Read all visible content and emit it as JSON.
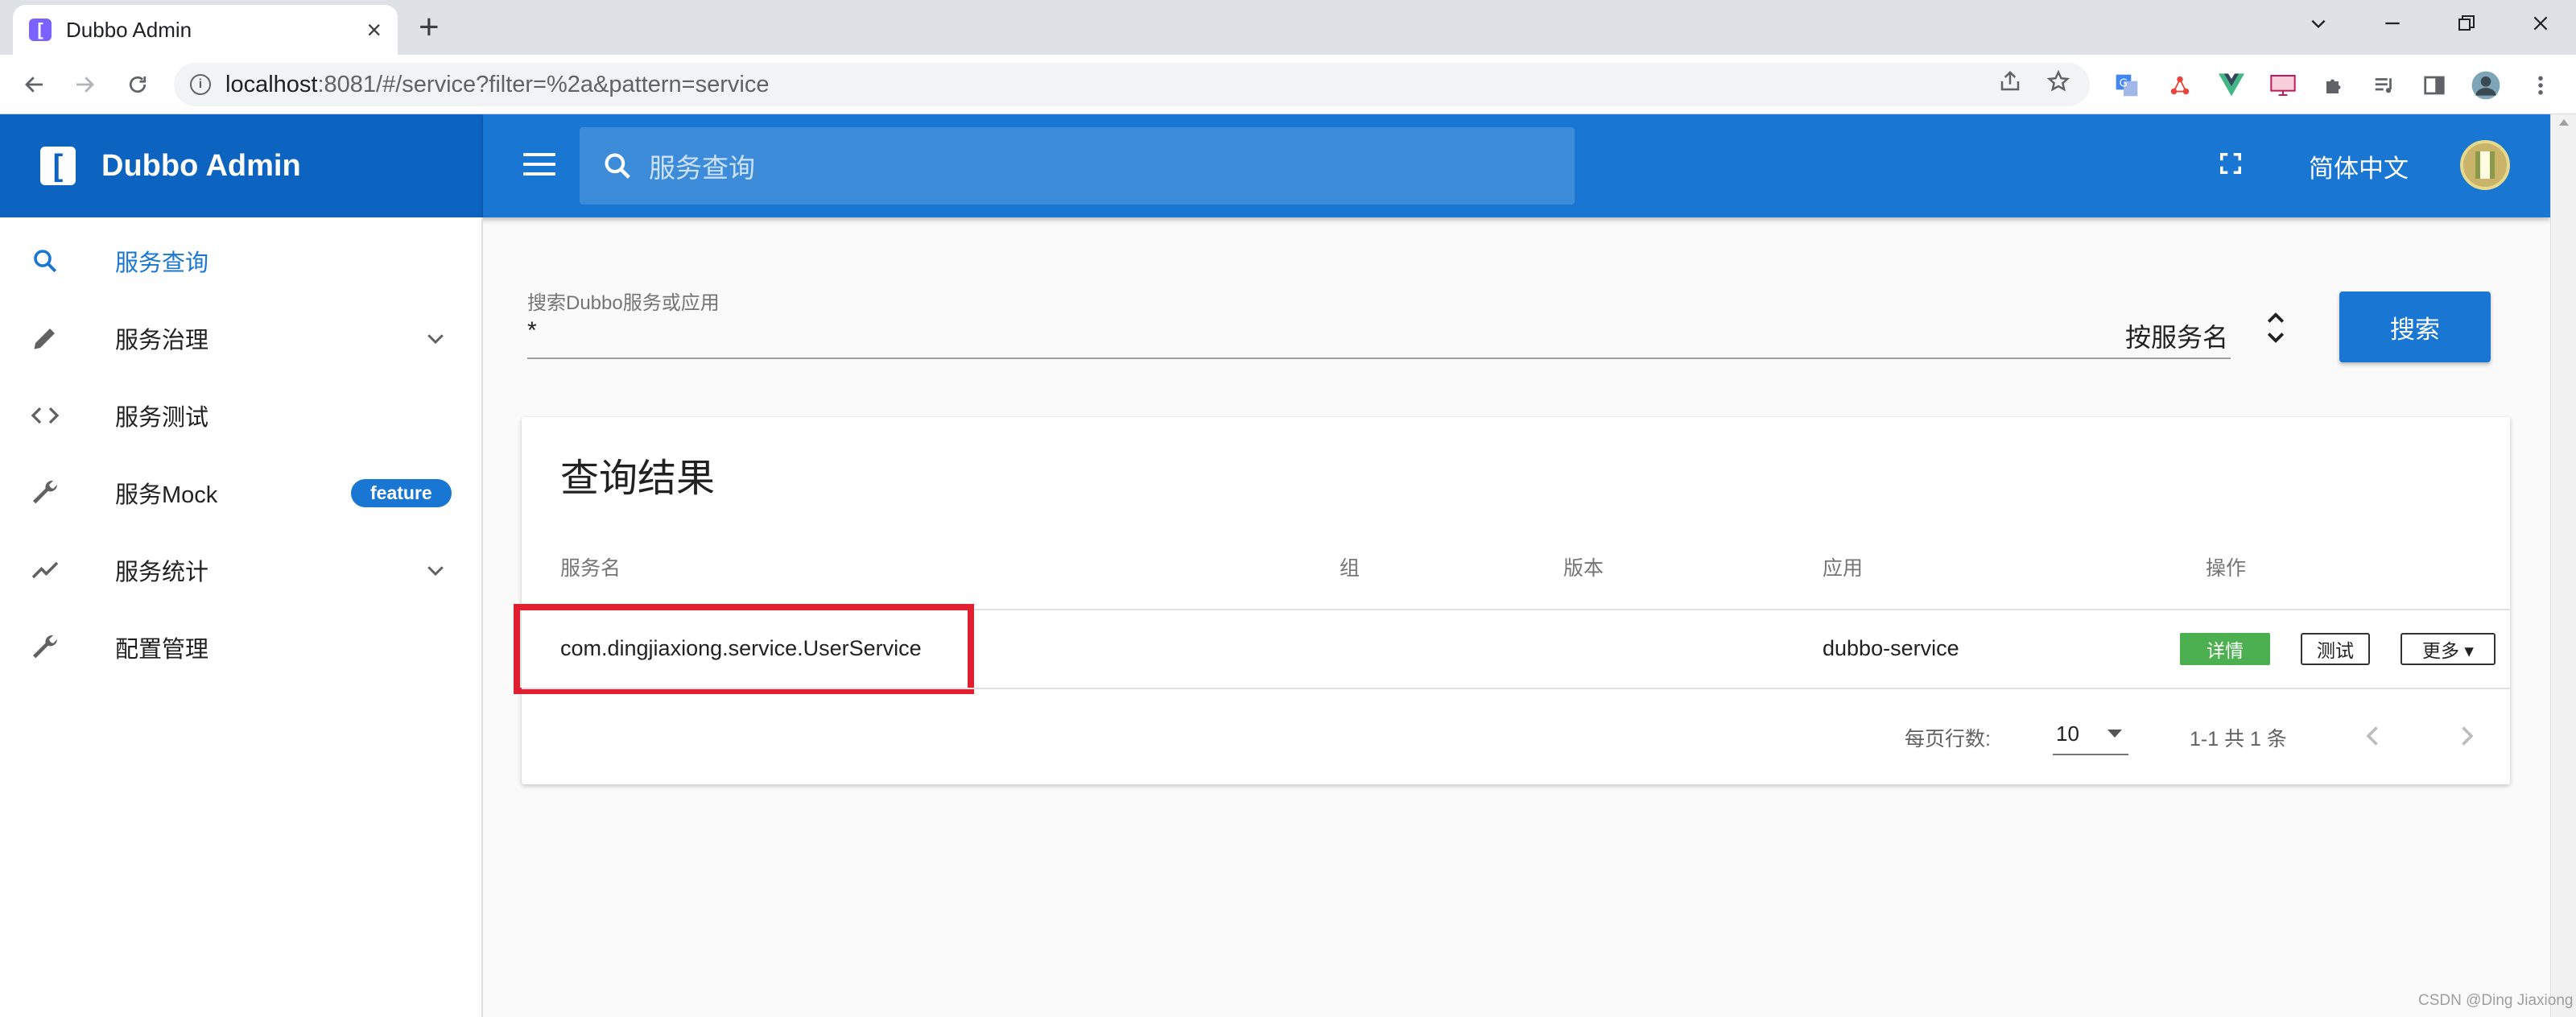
{
  "browser": {
    "tab_title": "Dubbo Admin",
    "tab_favicon": "[",
    "new_tab": "+",
    "close": "×",
    "url_host": "localhost",
    "url_rest": ":8081/#/service?filter=%2a&pattern=service",
    "window_controls": [
      "minimize-icon",
      "restore-icon",
      "close-icon"
    ]
  },
  "app": {
    "logo_glyph": "[",
    "brand": "Dubbo Admin",
    "header_search_placeholder": "服务查询",
    "language": "简体中文"
  },
  "sidebar": {
    "items": [
      {
        "label": "服务查询",
        "icon": "search-icon",
        "active": true
      },
      {
        "label": "服务治理",
        "icon": "pencil-icon",
        "expandable": true
      },
      {
        "label": "服务测试",
        "icon": "code-icon"
      },
      {
        "label": "服务Mock",
        "icon": "wrench-icon",
        "badge": "feature"
      },
      {
        "label": "服务统计",
        "icon": "trending-icon",
        "expandable": true
      },
      {
        "label": "配置管理",
        "icon": "wrench-icon"
      }
    ]
  },
  "search_form": {
    "label": "搜索Dubbo服务或应用",
    "value": "*",
    "pattern": "按服务名",
    "button": "搜索"
  },
  "results": {
    "title": "查询结果",
    "columns": [
      "服务名",
      "组",
      "版本",
      "应用",
      "操作"
    ],
    "rows": [
      {
        "service": "com.dingjiaxiong.service.UserService",
        "group": "",
        "version": "",
        "app": "dubbo-service"
      }
    ],
    "actions": {
      "detail": "详情",
      "test": "测试",
      "more": "更多 ▾"
    },
    "footer": {
      "rows_per_page_label": "每页行数:",
      "rows_per_page": "10",
      "range": "1-1 共 1 条"
    }
  },
  "colors": {
    "primary": "#1976d2",
    "header_dark": "#0d63c0",
    "detail_green": "#4caf50",
    "highlight_red": "#e02030"
  },
  "watermark": "CSDN @Ding Jiaxiong"
}
